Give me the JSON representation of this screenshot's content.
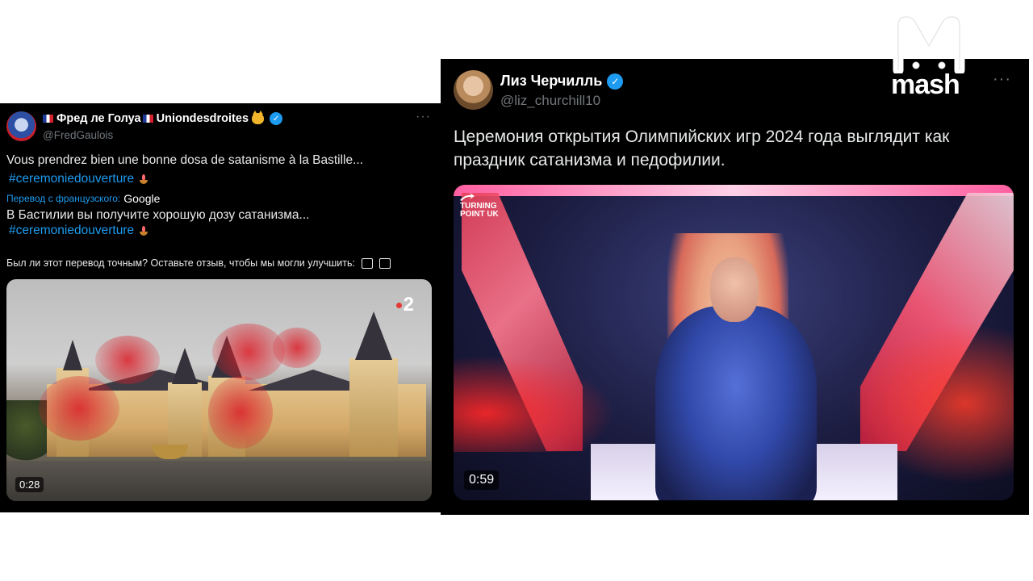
{
  "left_tweet": {
    "display_name": "Фред ле Голуа ",
    "display_name_2": "Uniondesdroites",
    "handle": "@FredGaulois",
    "original_text": "Vous prendrez bien une bonne dosa de satanisme à la Bastille...",
    "hashtag": "#ceremoniedouverture",
    "translation_label": "Перевод с французского:",
    "translation_provider": "Google",
    "translated_text": "В Бастилии вы получите хорошую дозу сатанизма...",
    "feedback_prompt": "Был ли этот перевод точным? Оставьте отзыв, чтобы мы могли улучшить:",
    "channel_logo": "2",
    "video_duration": "0:28",
    "more_label": "···"
  },
  "right_tweet": {
    "display_name": "Лиз Черчилль",
    "handle": "@liz_churchill10",
    "text": "Церемония открытия Олимпийских игр 2024 года выглядит как праздник сатанизма и педофилии.",
    "overlay_logo": "TURNING POINT UK",
    "video_duration": "0:59",
    "more_label": "···"
  },
  "watermark": {
    "text": "mash"
  },
  "colors": {
    "tweet_bg": "#000000",
    "link_blue": "#1d9bf0",
    "muted_gray": "#71767b",
    "page_bg": "#ffffff"
  }
}
